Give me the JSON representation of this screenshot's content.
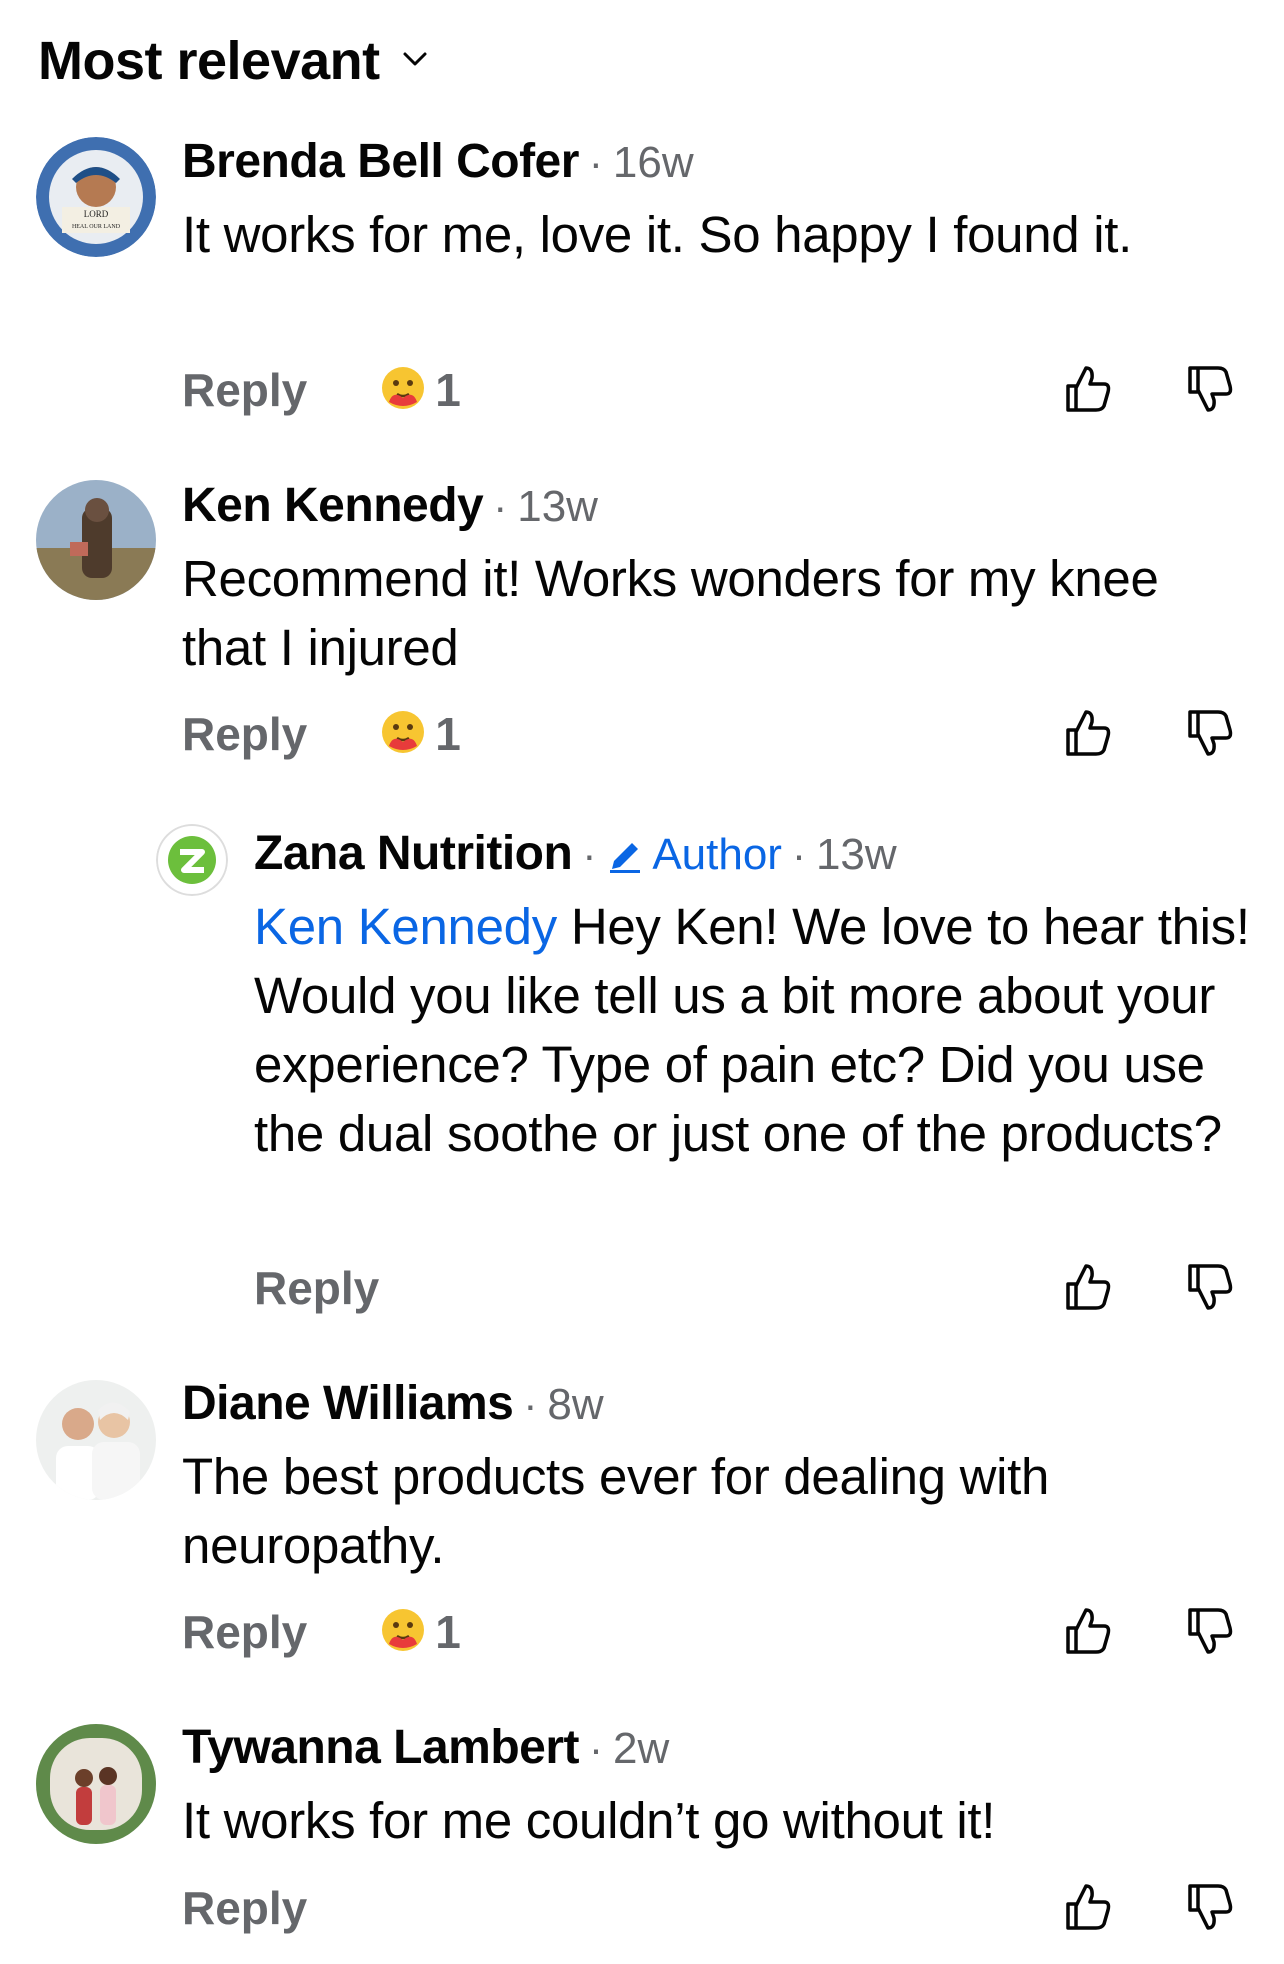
{
  "sort": {
    "label": "Most relevant"
  },
  "colors": {
    "link": "#0a66e4",
    "secondary": "#65676b",
    "text": "#050505"
  },
  "comments": [
    {
      "name": "Brenda Bell Cofer",
      "time": "16w",
      "text": "It works for me, love it. So happy I found it.",
      "reply_label": "Reply",
      "reaction": {
        "icon": "hug-emoji-icon",
        "count": "1"
      },
      "avatar_text": [
        "LORD",
        "HEAL OUR LAND"
      ]
    },
    {
      "name": "Ken Kennedy",
      "time": "13w",
      "text": "Recommend it! Works wonders for my knee that I injured",
      "reply_label": "Reply",
      "reaction": {
        "icon": "hug-emoji-icon",
        "count": "1"
      }
    },
    {
      "name": "Zana Nutrition",
      "author_badge": "Author",
      "time": "13w",
      "mention": "Ken Kennedy",
      "text": "Hey Ken! We love to hear this! Would you like tell us a bit more about your experience? Type of pain etc? Did you use the dual soothe or just one of the products?",
      "reply_label": "Reply"
    },
    {
      "name": "Diane Williams",
      "time": "8w",
      "text": "The best products ever for dealing with neuropathy.",
      "reply_label": "Reply",
      "reaction": {
        "icon": "hug-emoji-icon",
        "count": "1"
      }
    },
    {
      "name": "Tywanna Lambert",
      "time": "2w",
      "text": "It works for me couldn’t go without it!",
      "reply_label": "Reply"
    }
  ]
}
